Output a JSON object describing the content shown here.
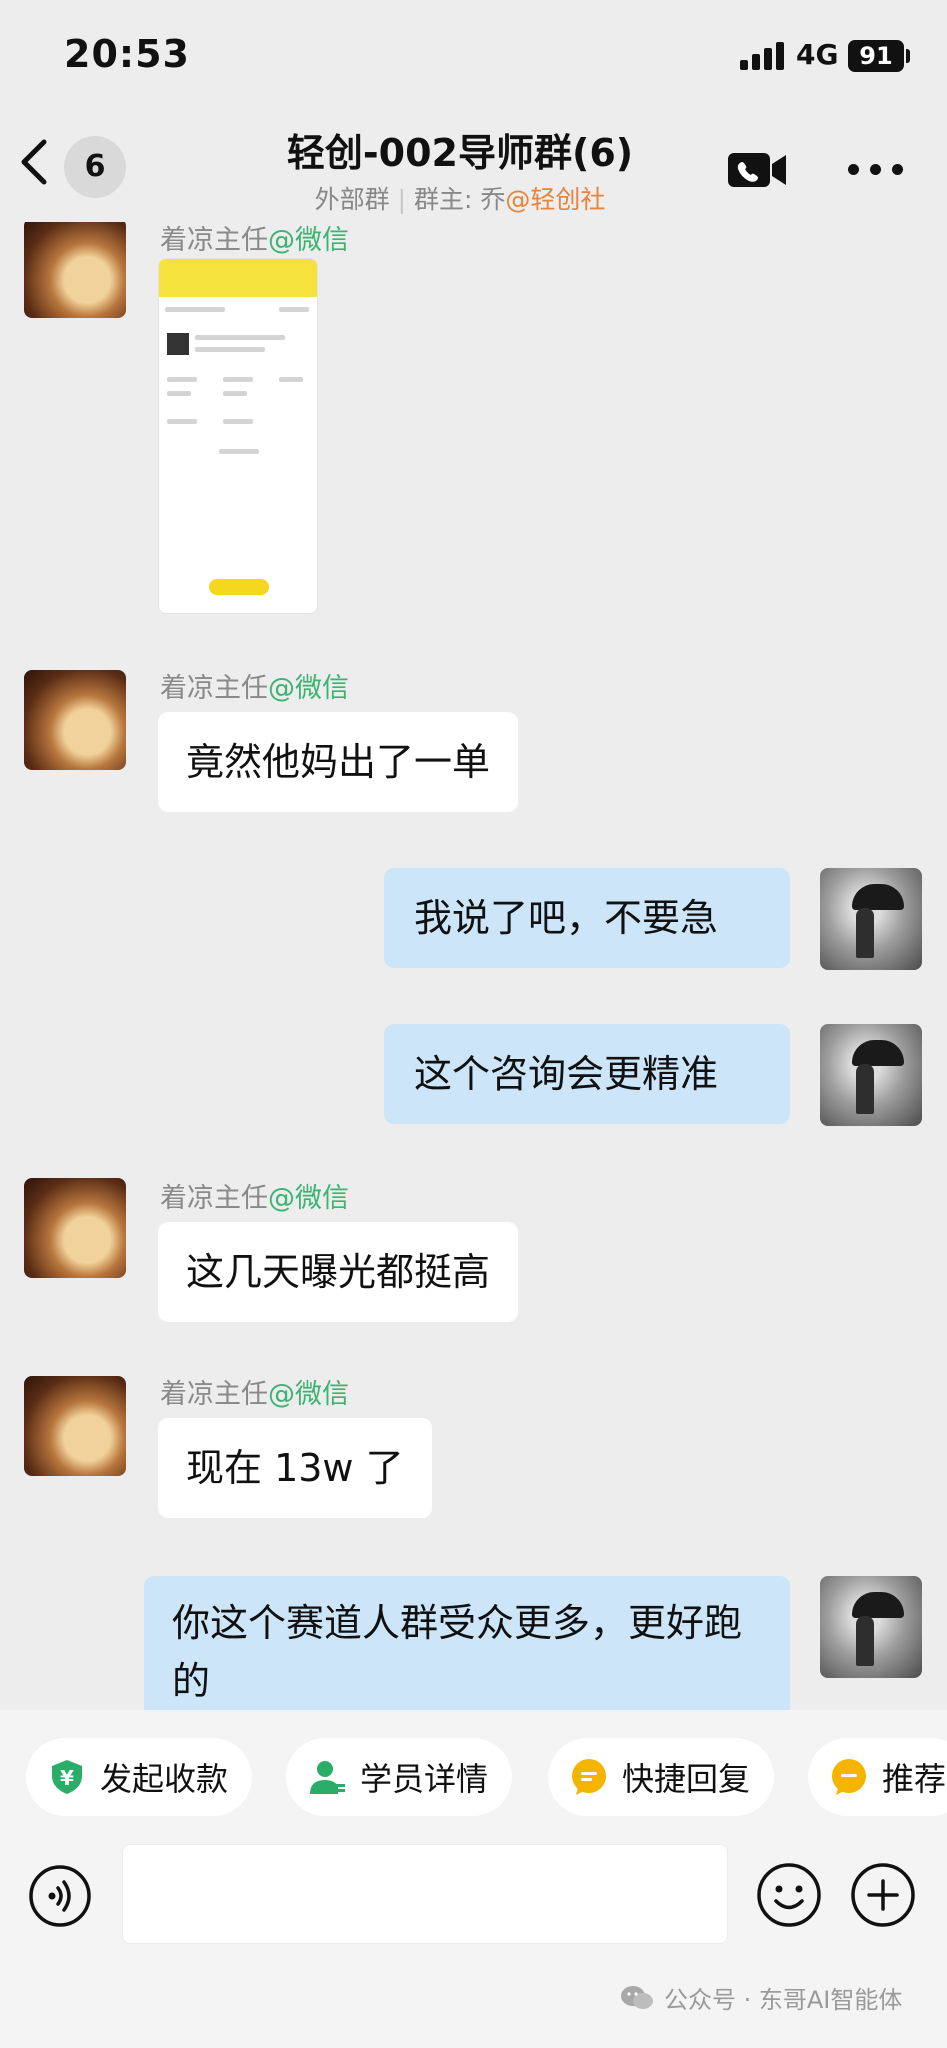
{
  "status_bar": {
    "time": "20:53",
    "network": "4G",
    "battery": "91"
  },
  "header": {
    "back_icon": "chevron-left-icon",
    "unread_count": "6",
    "title": "轻创-002导师群(6)",
    "subtitle_type": "外部群",
    "subtitle_owner_prefix": "群主: 乔",
    "subtitle_owner_link": "@轻创社",
    "video_call_icon": "video-call-icon",
    "more_icon": "more-icon"
  },
  "messages": [
    {
      "sender": "着凉主任",
      "sender_tag": "@微信",
      "type": "image"
    },
    {
      "sender": "着凉主任",
      "sender_tag": "@微信",
      "text": "竟然他妈出了一单"
    },
    {
      "from_me": true,
      "text": "我说了吧，不要急"
    },
    {
      "from_me": true,
      "text": "这个咨询会更精准"
    },
    {
      "sender": "着凉主任",
      "sender_tag": "@微信",
      "text": "这几天曝光都挺高"
    },
    {
      "sender": "着凉主任",
      "sender_tag": "@微信",
      "text": "现在 13w 了"
    },
    {
      "from_me": true,
      "text": "你这个赛道人群受众更多，更好跑的"
    }
  ],
  "quick_actions": [
    {
      "label": "发起收款",
      "icon": "yuan-shield-icon",
      "color": "#2aae67"
    },
    {
      "label": "学员详情",
      "icon": "person-icon",
      "color": "#2aae67"
    },
    {
      "label": "快捷回复",
      "icon": "chat-bubble-icon",
      "color": "#f4b400"
    },
    {
      "label": "推荐",
      "icon": "chat-bubble-icon",
      "color": "#f4b400"
    }
  ],
  "input": {
    "placeholder": "",
    "voice_icon": "voice-icon",
    "emoji_icon": "emoji-icon",
    "plus_icon": "plus-icon"
  },
  "watermark": "公众号 · 东哥AI智能体"
}
